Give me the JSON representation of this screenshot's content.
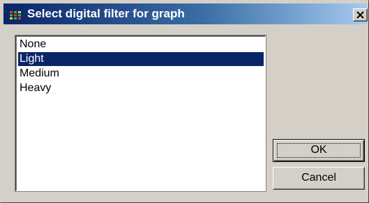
{
  "window": {
    "title": "Select digital filter for graph",
    "icon": "app-grid-icon",
    "close_icon": "close-icon"
  },
  "filter_list": {
    "items": [
      {
        "label": "None",
        "selected": false
      },
      {
        "label": "Light",
        "selected": true
      },
      {
        "label": "Medium",
        "selected": false
      },
      {
        "label": "Heavy",
        "selected": false
      }
    ]
  },
  "buttons": {
    "ok_label": "OK",
    "cancel_label": "Cancel"
  },
  "colors": {
    "selection": "#0a246a",
    "titlebar_start": "#0a246a",
    "titlebar_end": "#a6caf0",
    "face": "#d4d0c8"
  }
}
